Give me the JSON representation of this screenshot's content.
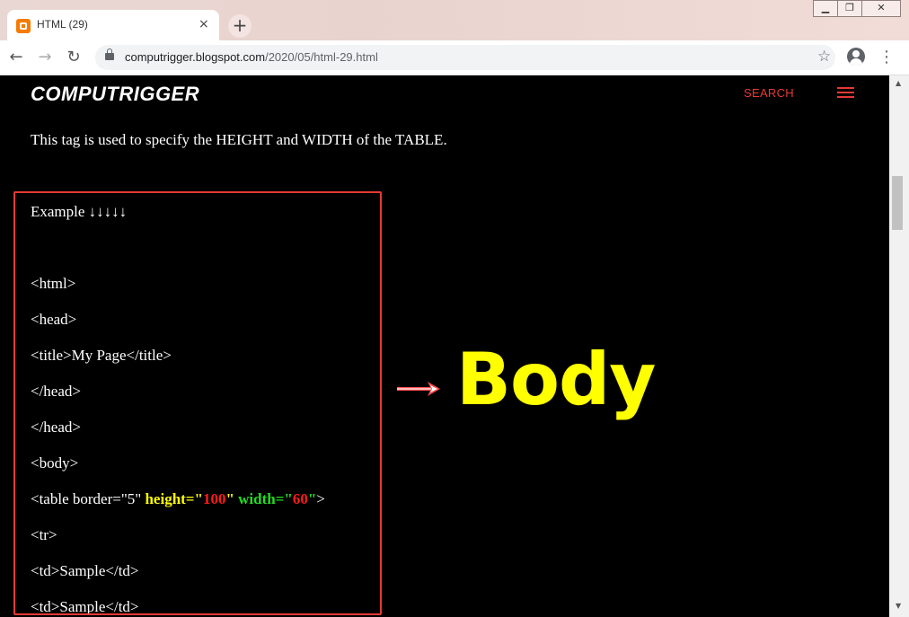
{
  "browser": {
    "tab_title": "HTML (29)",
    "tab_close": "×",
    "new_tab": "+",
    "url_host": "computrigger.blogspot.com",
    "url_path": "/2020/05/html-29.html",
    "win_minimize": "▁",
    "win_restore": "❐",
    "win_close": "✕",
    "back": "←",
    "forward": "→",
    "reload": "↻",
    "star": "☆",
    "menu": "⋮"
  },
  "site": {
    "brand": "COMPUTRIGGER",
    "search_label": "SEARCH",
    "accent": "#e53935"
  },
  "article": {
    "intro": "This tag is used to specify the HEIGHT and WIDTH of the TABLE.",
    "example_title": "Example ↓↓↓↓↓",
    "lines": {
      "html": "<html>",
      "head": "<head>",
      "title": "<title>My Page</title>",
      "head_close_1": "</head>",
      "head_close_2": "</head>",
      "body": "<body>",
      "table_prefix": "<table border=\"5\" ",
      "height_attr": "height=\"",
      "height_val": "100",
      "height_q": "\"",
      "width_attr": " width=\"",
      "width_val": "60",
      "width_q": "\"",
      "table_suffix": ">",
      "tr": "<tr>",
      "td1": "<td>Sample</td>",
      "td2": "<td>Sample</td>"
    },
    "callout": "Body"
  },
  "colors": {
    "highlight_yellow": "#ffff00",
    "highlight_red": "#ff1a1a",
    "highlight_green": "#22dd22"
  }
}
